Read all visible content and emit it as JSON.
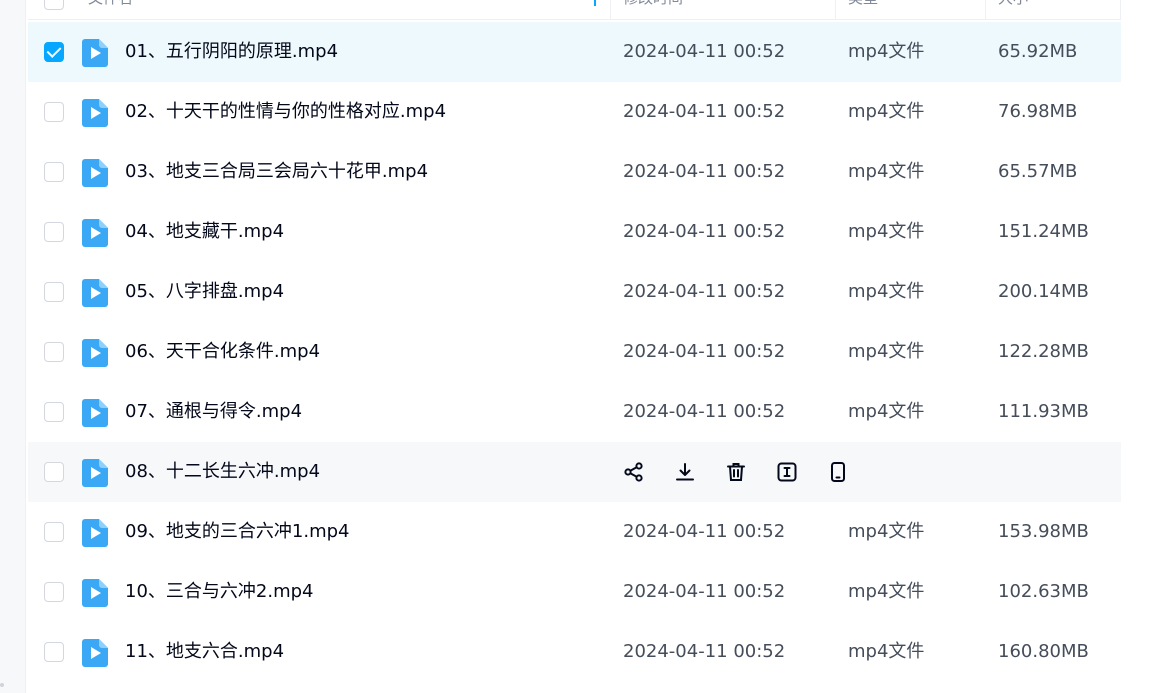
{
  "header": {
    "name_col": "文件名",
    "time_col": "修改时间",
    "type_col": "类型",
    "size_col": "大小"
  },
  "colors": {
    "accent": "#06a7ff",
    "selected_row_bg": "#eef9fe",
    "hover_row_bg": "#f7f8fa",
    "file_icon": "#3aa8f5"
  },
  "rows": [
    {
      "name": "01、五行阴阳的原理.mp4",
      "time": "2024-04-11 00:52",
      "type": "mp4文件",
      "size": "65.92MB",
      "checked": true
    },
    {
      "name": "02、十天干的性情与你的性格对应.mp4",
      "time": "2024-04-11 00:52",
      "type": "mp4文件",
      "size": "76.98MB",
      "checked": false
    },
    {
      "name": "03、地支三合局三会局六十花甲.mp4",
      "time": "2024-04-11 00:52",
      "type": "mp4文件",
      "size": "65.57MB",
      "checked": false
    },
    {
      "name": "04、地支藏干.mp4",
      "time": "2024-04-11 00:52",
      "type": "mp4文件",
      "size": "151.24MB",
      "checked": false
    },
    {
      "name": "05、八字排盘.mp4",
      "time": "2024-04-11 00:52",
      "type": "mp4文件",
      "size": "200.14MB",
      "checked": false
    },
    {
      "name": "06、天干合化条件.mp4",
      "time": "2024-04-11 00:52",
      "type": "mp4文件",
      "size": "122.28MB",
      "checked": false
    },
    {
      "name": "07、通根与得令.mp4",
      "time": "2024-04-11 00:52",
      "type": "mp4文件",
      "size": "111.93MB",
      "checked": false
    },
    {
      "name": "08、十二长生六冲.mp4",
      "time": "",
      "type": "",
      "size": "",
      "checked": false,
      "hovered": true
    },
    {
      "name": "09、地支的三合六冲1.mp4",
      "time": "2024-04-11 00:52",
      "type": "mp4文件",
      "size": "153.98MB",
      "checked": false
    },
    {
      "name": "10、三合与六冲2.mp4",
      "time": "2024-04-11 00:52",
      "type": "mp4文件",
      "size": "102.63MB",
      "checked": false
    },
    {
      "name": "11、地支六合.mp4",
      "time": "2024-04-11 00:52",
      "type": "mp4文件",
      "size": "160.80MB",
      "checked": false
    }
  ],
  "hover_actions": [
    {
      "name": "share-icon"
    },
    {
      "name": "download-icon"
    },
    {
      "name": "delete-icon"
    },
    {
      "name": "rename-icon"
    },
    {
      "name": "phone-icon"
    }
  ]
}
